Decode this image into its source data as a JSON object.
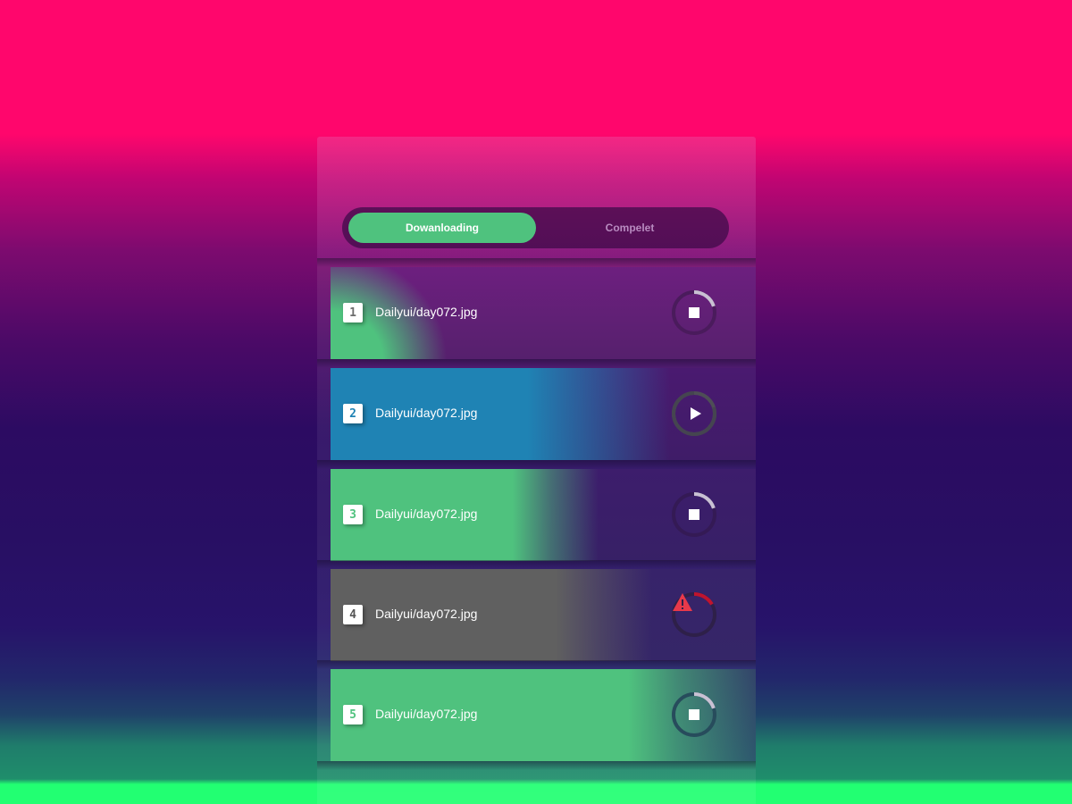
{
  "colors": {
    "accent_green": "#4fc27e",
    "accent_blue": "#1f83b4",
    "error_gray": "#606060",
    "error_red": "#e8394a",
    "ring_track": "#3b2055",
    "ring_progress": "#c9c1d3"
  },
  "tabs": [
    {
      "label": "Dowanloading",
      "active": true
    },
    {
      "label": "Compelet",
      "active": false
    }
  ],
  "downloads": [
    {
      "index": "1",
      "file": "Dailyui/day072.jpg",
      "state": "downloading",
      "action_icon": "stop-icon",
      "progress": 0.15,
      "fill_color": "#4fc27e"
    },
    {
      "index": "2",
      "file": "Dailyui/day072.jpg",
      "state": "paused",
      "action_icon": "play-icon",
      "progress": 0.55,
      "fill_color": "#1f83b4"
    },
    {
      "index": "3",
      "file": "Dailyui/day072.jpg",
      "state": "downloading",
      "action_icon": "stop-icon",
      "progress": 0.45,
      "fill_color": "#4fc27e"
    },
    {
      "index": "4",
      "file": "Dailyui/day072.jpg",
      "state": "error",
      "action_icon": "warning-icon",
      "progress": 0.6,
      "fill_color": "#606060"
    },
    {
      "index": "5",
      "file": "Dailyui/day072.jpg",
      "state": "downloading",
      "action_icon": "stop-icon",
      "progress": 0.8,
      "fill_color": "#4fc27e"
    }
  ]
}
